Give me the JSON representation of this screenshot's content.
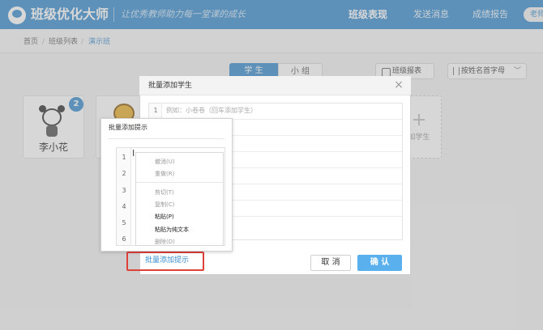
{
  "app": {
    "logo_text": "班级优化大师",
    "slogan": "让优秀教师助力每一堂课的成长"
  },
  "nav": {
    "class_performance": "班级表现",
    "send_message": "发送消息",
    "grade_report": "成绩报告",
    "avatar_text": "老师"
  },
  "breadcrumb": {
    "home": "首页",
    "class_list": "班级列表",
    "current": "演示班",
    "separator": "/"
  },
  "toolbar": {
    "tab_students": "学 生",
    "tab_groups": "小 组",
    "report_button": "班级报表",
    "sort_button": "按姓名首字母",
    "sort_chevron": "﹀"
  },
  "students": [
    {
      "name": "李小花",
      "badge": "2"
    }
  ],
  "add_student_card": {
    "plus": "+",
    "label": "加学生"
  },
  "dialog": {
    "title": "批量添加学生",
    "close": "×",
    "editor_lines": [
      "1"
    ],
    "placeholder": "例如：小卷卷（回车添加学生）",
    "cancel_label": "取 消",
    "confirm_label": "确 认",
    "hint_link": "批量添加提示"
  },
  "hint_panel": {
    "title": "批量添加提示",
    "line_numbers": [
      "1",
      "2",
      "3",
      "4",
      "5",
      "6"
    ],
    "cursor": "I",
    "context_menu": {
      "undo": "撤消(U)",
      "redo": "重做(R)",
      "cut": "剪切(T)",
      "copy": "复制(C)",
      "paste": "粘贴(P)",
      "paste_plain": "粘贴为纯文本",
      "delete": "删除(D)"
    }
  }
}
